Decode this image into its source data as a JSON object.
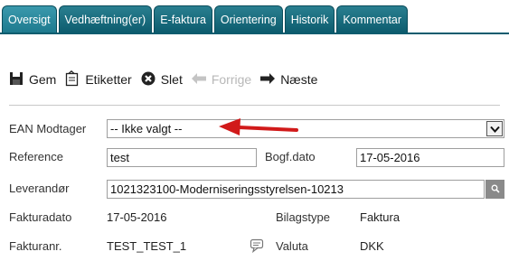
{
  "tabs": [
    "Oversigt",
    "Vedhæftning(er)",
    "E-faktura",
    "Orientering",
    "Historik",
    "Kommentar"
  ],
  "toolbar": {
    "save": "Gem",
    "labels": "Etiketter",
    "delete": "Slet",
    "previous": "Forrige",
    "next": "Næste"
  },
  "form": {
    "ean_label": "EAN Modtager",
    "ean_value": "-- Ikke valgt --",
    "reference_label": "Reference",
    "reference_value": "test",
    "bogf_label": "Bogf.dato",
    "bogf_value": "17-05-2016",
    "supplier_label": "Leverandør",
    "supplier_value": "1021323100-Moderniseringsstyrelsen-10213",
    "invoice_date_label": "Fakturadato",
    "invoice_date_value": "17-05-2016",
    "voucher_type_label": "Bilagstype",
    "voucher_type_value": "Faktura",
    "invoice_no_label": "Fakturanr.",
    "invoice_no_value": "TEST_TEST_1",
    "currency_label": "Valuta",
    "currency_value": "DKK"
  },
  "colors": {
    "tab_bg": "#0d5c6e",
    "tab_active_bg": "#1e7a8e",
    "arrow": "#d11a1a",
    "disabled": "#b8b8b8"
  },
  "icons": [
    "save-icon",
    "labels-icon",
    "delete-icon",
    "previous-arrow-icon",
    "next-arrow-icon",
    "chevron-down-icon",
    "search-icon",
    "comment-icon",
    "red-arrow-annotation"
  ]
}
